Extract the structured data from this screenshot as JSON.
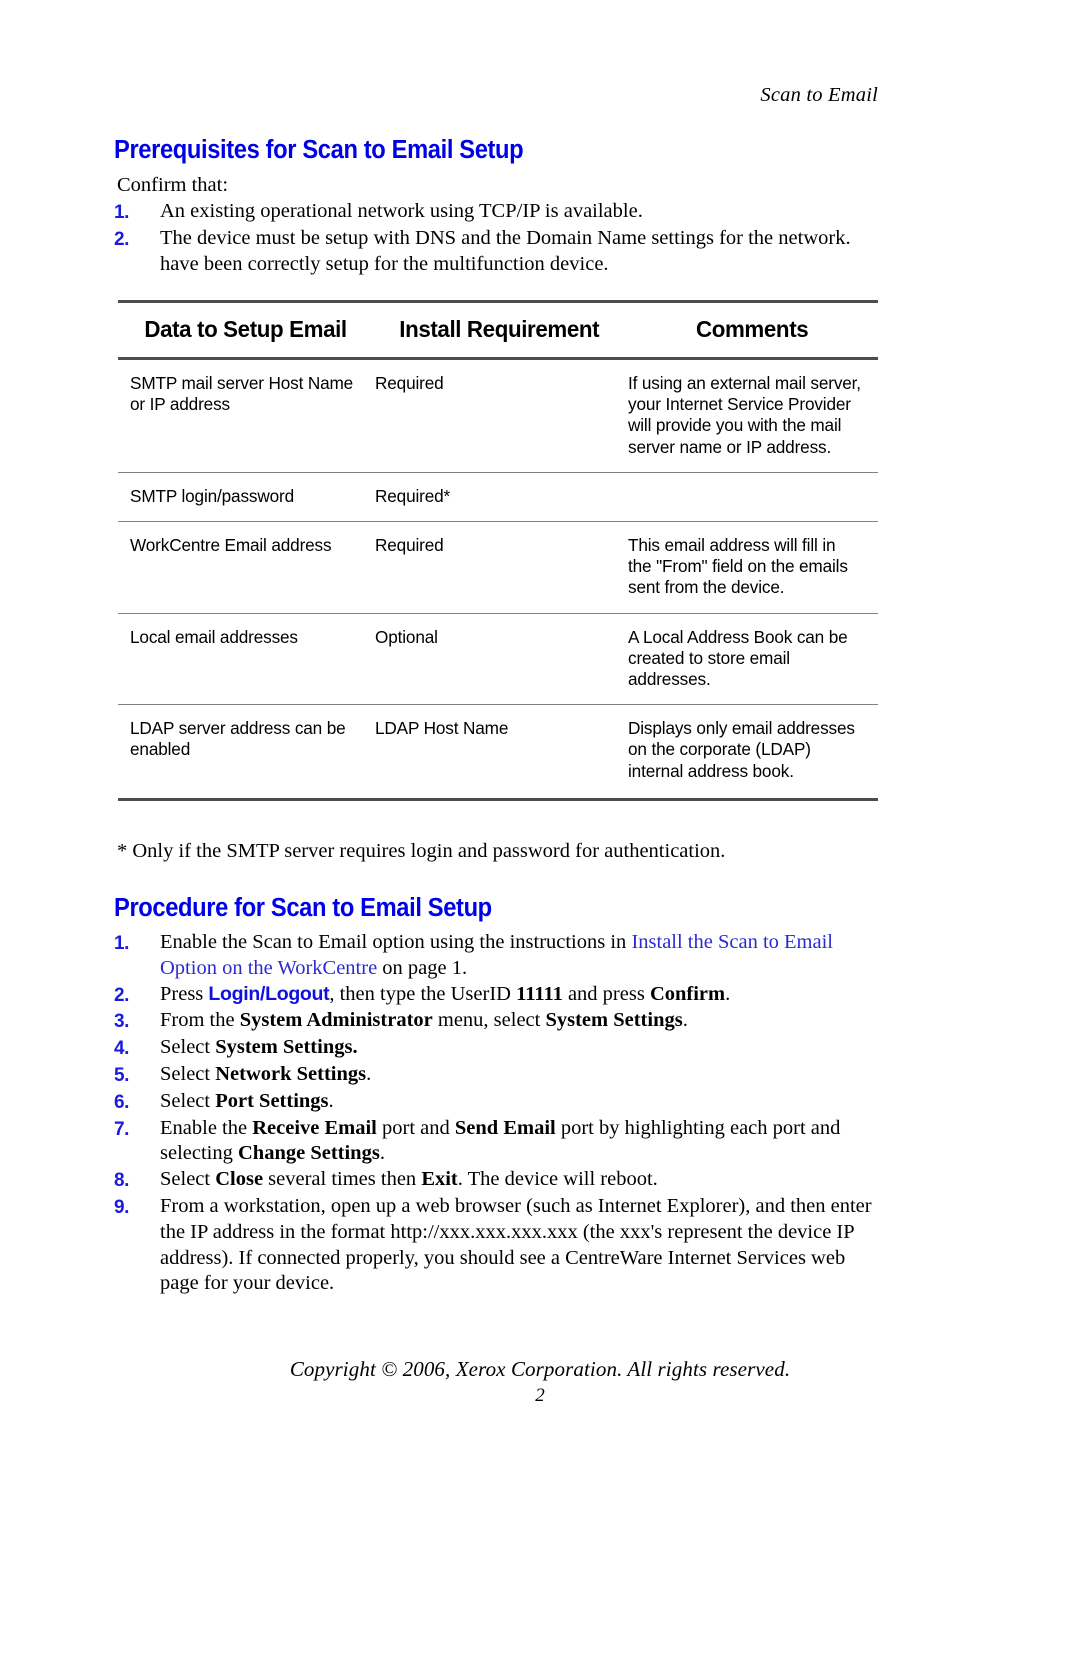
{
  "running_header": "Scan to Email",
  "sections": {
    "prerequisites": {
      "heading": "Prerequisites for Scan to Email Setup",
      "intro": "Confirm that:",
      "items": [
        {
          "marker": "1.",
          "text": "An existing operational network using TCP/IP is available."
        },
        {
          "marker": "2.",
          "text": "The device must be setup with DNS and the Domain Name settings for the network. have been correctly setup for the multifunction device."
        }
      ]
    },
    "procedure": {
      "heading": "Procedure for Scan to Email Setup",
      "steps": [
        {
          "marker": "1."
        },
        {
          "marker": "2."
        },
        {
          "marker": "3."
        },
        {
          "marker": "4."
        },
        {
          "marker": "5."
        },
        {
          "marker": "6."
        },
        {
          "marker": "7."
        },
        {
          "marker": "8."
        },
        {
          "marker": "9."
        }
      ],
      "step_text": {
        "s1_a": "Enable the Scan to Email option using the instructions in ",
        "s1_link": "Install the Scan to Email Option on the WorkCentre",
        "s1_b": " on page 1.",
        "s2_a": "Press ",
        "s2_key": "Login/Logout",
        "s2_b": ", then type the UserID ",
        "s2_userid": "11111",
        "s2_c": " and press ",
        "s2_confirm": "Confirm",
        "s2_d": ".",
        "s3_a": "From the ",
        "s3_b1": "System Administrator",
        "s3_b": " menu, select ",
        "s3_b2": "System Settings",
        "s3_c": ".",
        "s4_a": "Select ",
        "s4_b": "System Settings.",
        "s5_a": "Select ",
        "s5_b": "Network Settings",
        "s5_c": ".",
        "s6_a": "Select ",
        "s6_b": "Port Settings",
        "s6_c": ".",
        "s7_a": "Enable the ",
        "s7_b1": "Receive Email",
        "s7_b": " port and ",
        "s7_b2": "Send Email",
        "s7_c": " port by highlighting each port and selecting ",
        "s7_b3": "Change Settings",
        "s7_d": ".",
        "s8_a": "Select ",
        "s8_b1": "Close",
        "s8_b": " several times then ",
        "s8_b2": "Exit",
        "s8_c": ". The device will reboot.",
        "s9": "From a workstation, open up a web browser (such as Internet Explorer), and then enter the IP address in the format http://xxx.xxx.xxx.xxx (the xxx's represent the device IP address). If connected properly, you should see a CentreWare Internet Services web page for your device."
      }
    }
  },
  "table": {
    "headers": [
      "Data to Setup Email",
      "Install Requirement",
      "Comments"
    ],
    "rows": [
      {
        "data": "SMTP mail server Host Name or IP address",
        "requirement": "Required",
        "comments": "If using an external mail server, your Internet Service Provider will provide you with the mail server name or IP address."
      },
      {
        "data": "SMTP login/password",
        "requirement": "Required*",
        "comments": ""
      },
      {
        "data": "WorkCentre Email address",
        "requirement": "Required",
        "comments": "This email address will fill in the \"From\" field on the emails sent from the device."
      },
      {
        "data": "Local email addresses",
        "requirement": "Optional",
        "comments": "A Local Address Book can be created to store email addresses."
      },
      {
        "data": "LDAP server address can be enabled",
        "requirement": "LDAP Host Name",
        "comments": "Displays only email addresses on the corporate (LDAP) internal address book."
      }
    ]
  },
  "footnote": "* Only if the SMTP server requires login and password for authentication.",
  "footer": {
    "copyright": "Copyright © 2006, Xerox Corporation. All rights reserved.",
    "page_number": "2"
  },
  "colors": {
    "heading_blue": "#0000e8",
    "marker_blue": "#1a1ae0",
    "link_blue": "#2a2ad0",
    "rule_dark": "#4d4d4d",
    "rule_light": "#808080"
  }
}
